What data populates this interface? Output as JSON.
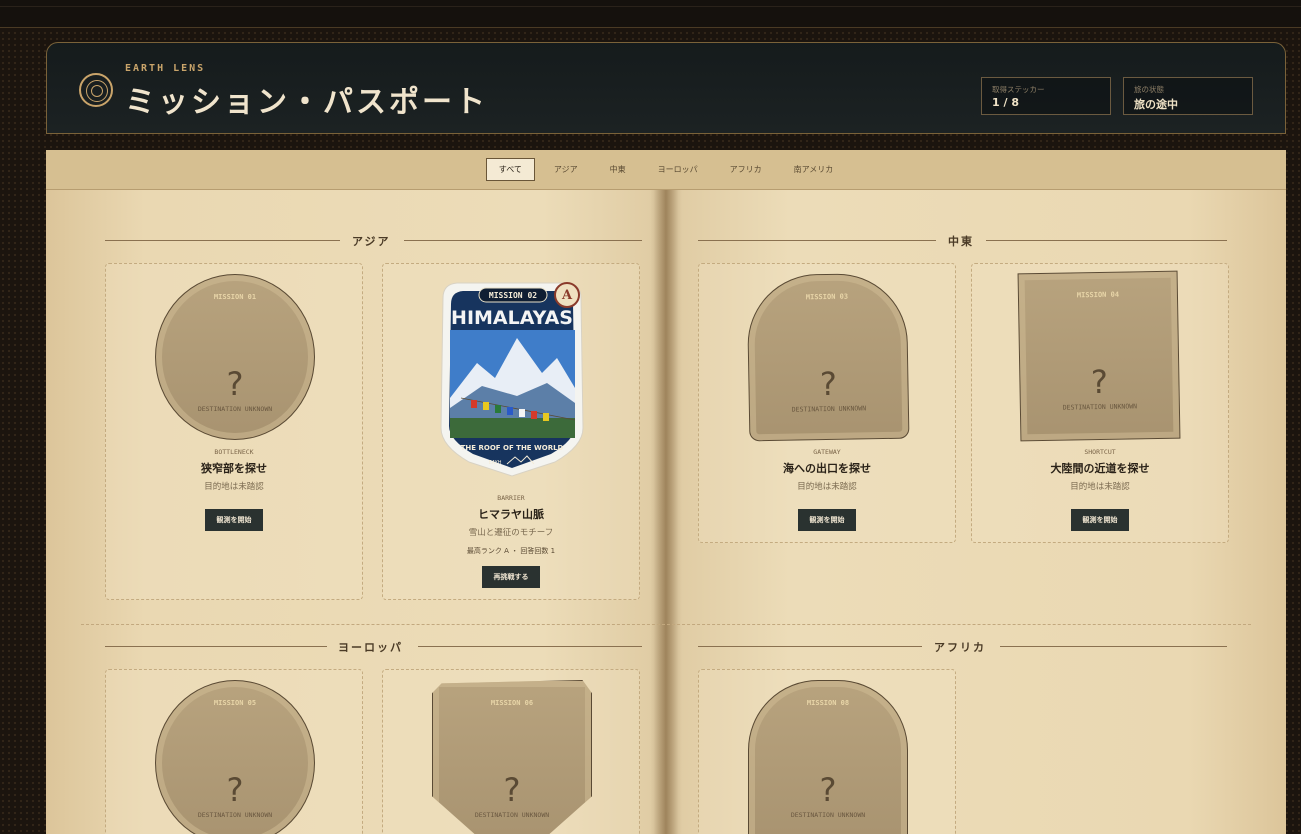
{
  "header": {
    "brand": "EARTH LENS",
    "title": "ミッション・パスポート",
    "stats": [
      {
        "label": "取得ステッカー",
        "value": "1 / 8"
      },
      {
        "label": "旅の状態",
        "value": "旅の途中"
      }
    ]
  },
  "tabs": [
    "すべて",
    "アジア",
    "中東",
    "ヨーロッパ",
    "アフリカ",
    "南アメリカ"
  ],
  "active_tab": "すべて",
  "sections": {
    "asia": "アジア",
    "middle_east": "中東",
    "europe": "ヨーロッパ",
    "africa": "アフリカ"
  },
  "unknown_label": "DESTINATION UNKNOWN",
  "unknown_subtitle": "目的地は未踏認",
  "start_label": "観測を開始",
  "missions": {
    "m1": {
      "no": "MISSION 01",
      "category": "BOTTLENECK",
      "name": "狭窄部を探せ"
    },
    "m2": {
      "no": "MISSION 02",
      "category": "BARRIER",
      "name": "ヒマラヤ山脈",
      "subtitle": "雪山と遷征のモチーフ",
      "meta": "最高ランク A ・ 回答回数 1",
      "button": "再挑戦する",
      "rank": "A",
      "sticker_title": "HIMALAYAS",
      "sticker_tagline": "THE ROOF OF THE WORLD",
      "sticker_brand": "EAYH"
    },
    "m3": {
      "no": "MISSION 03",
      "category": "GATEWAY",
      "name": "海への出口を探せ"
    },
    "m4": {
      "no": "MISSION 04",
      "category": "SHORTCUT",
      "name": "大陸間の近道を探せ"
    },
    "m5": {
      "no": "MISSION 05"
    },
    "m6": {
      "no": "MISSION 06"
    },
    "m8": {
      "no": "MISSION 08"
    }
  },
  "colors": {
    "accent": "#c9a46a",
    "button": "#2a3230",
    "rank": "#8a3a2a"
  }
}
